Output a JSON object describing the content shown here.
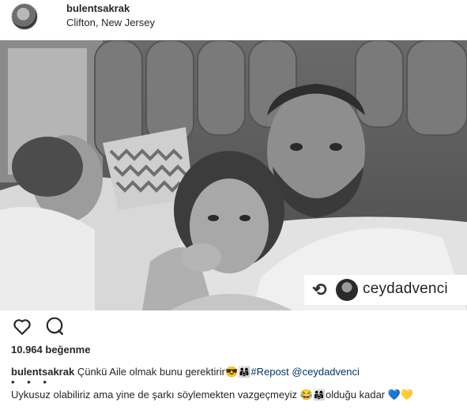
{
  "post": {
    "username": "bulentsakrak",
    "location": "Clifton, New Jersey"
  },
  "photo": {
    "repost_icon": "repost-icon",
    "repost_username": "ceydadvenci"
  },
  "actions": {
    "like_icon": "heart-icon",
    "comment_icon": "comment-icon"
  },
  "likes": "10.964 beğenme",
  "caption": {
    "username": "bulentsakrak",
    "text": "Çünkü Aile olmak bunu gerektirir😎👨‍👩‍👧",
    "hashtag": "#Repost",
    "mention": "@ceydadvenci",
    "dots": "• • •",
    "line2": "Uykusuz olabiliriz ama yine de şarkı söylemekten vazgeçmeyiz 😂👨‍👩‍👧olduğu kadar 💙💛"
  },
  "colors": {
    "link": "#003569",
    "text": "#262626"
  }
}
